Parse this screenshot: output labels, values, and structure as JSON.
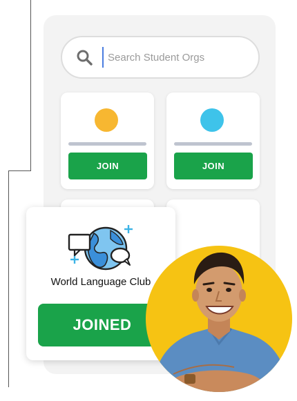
{
  "search": {
    "placeholder": "Search Student Orgs",
    "value": ""
  },
  "cards": [
    {
      "join_label": "JOIN",
      "dot_color": "#f7b731"
    },
    {
      "join_label": "JOIN",
      "dot_color": "#3ec3ea"
    }
  ],
  "featured": {
    "club_name": "World Language Club",
    "status_label": "JOINED",
    "icon": "globe-speech-bubbles-icon"
  },
  "colors": {
    "accent_green": "#1aa34a",
    "avatar_bg": "#f6c313",
    "globe_blue": "#7fc5f0",
    "sparkle": "#3bb3e6"
  },
  "avatar": {
    "icon": "student-avatar"
  }
}
